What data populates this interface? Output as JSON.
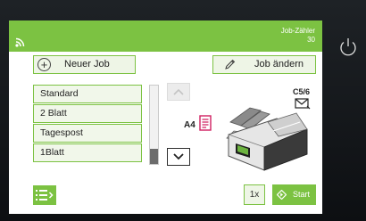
{
  "header": {
    "counter_label": "Job-Zähler",
    "counter_value": "30",
    "wifi_icon": "wifi-icon"
  },
  "toolbar": {
    "new_job_label": "Neuer Job",
    "edit_job_label": "Job ändern"
  },
  "jobs": [
    {
      "label": "Standard"
    },
    {
      "label": "2 Blatt"
    },
    {
      "label": "Tagespost"
    },
    {
      "label": "1Blatt"
    }
  ],
  "machine": {
    "paper_label": "A4",
    "envelope_label": "C5/6"
  },
  "footer": {
    "copies_label": "1x",
    "start_label": "Start"
  },
  "colors": {
    "accent": "#7cc242",
    "button_bg": "#eef5e6"
  }
}
